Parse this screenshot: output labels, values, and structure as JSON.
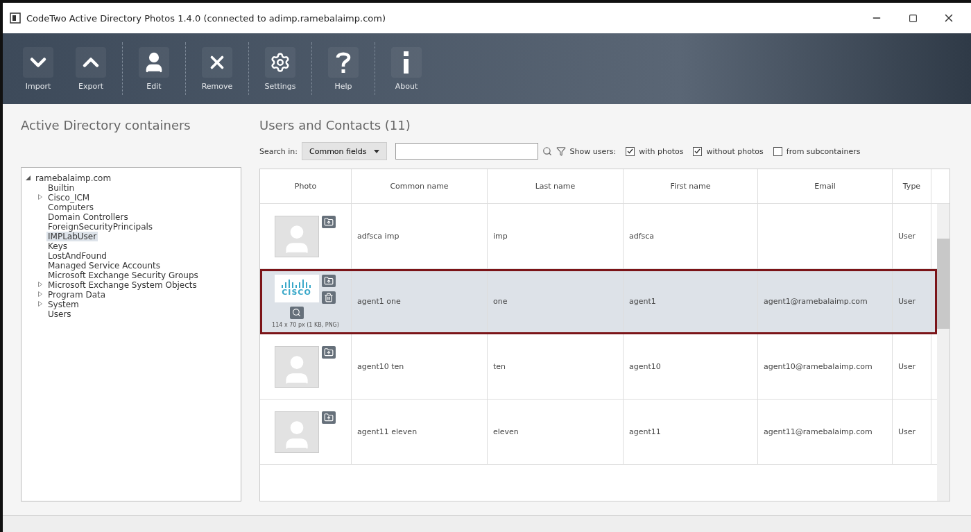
{
  "window": {
    "title": "CodeTwo Active Directory Photos 1.4.0 (connected to adimp.ramebalaimp.com)"
  },
  "toolbar": [
    {
      "label": "Import",
      "kind": "import"
    },
    {
      "label": "Export",
      "kind": "export"
    },
    {
      "label": "Edit",
      "kind": "edit"
    },
    {
      "label": "Remove",
      "kind": "remove"
    },
    {
      "label": "Settings",
      "kind": "settings"
    },
    {
      "label": "Help",
      "kind": "help"
    },
    {
      "label": "About",
      "kind": "about"
    }
  ],
  "sidebar": {
    "title": "Active Directory containers",
    "tree": [
      {
        "label": "ramebalaimp.com",
        "expanded": true,
        "selected": false,
        "children": [
          {
            "label": "Builtin",
            "selected": false
          },
          {
            "label": "Cisco_ICM",
            "expanded": false,
            "selected": false
          },
          {
            "label": "Computers",
            "selected": false
          },
          {
            "label": "Domain Controllers",
            "selected": false
          },
          {
            "label": "ForeignSecurityPrincipals",
            "selected": false
          },
          {
            "label": "IMPLabUser",
            "selected": true
          },
          {
            "label": "Keys",
            "selected": false
          },
          {
            "label": "LostAndFound",
            "selected": false
          },
          {
            "label": "Managed Service Accounts",
            "selected": false
          },
          {
            "label": "Microsoft Exchange Security Groups",
            "selected": false
          },
          {
            "label": "Microsoft Exchange System Objects",
            "expanded": false,
            "selected": false
          },
          {
            "label": "Program Data",
            "expanded": false,
            "selected": false
          },
          {
            "label": "System",
            "expanded": false,
            "selected": false
          },
          {
            "label": "Users",
            "selected": false
          }
        ]
      }
    ]
  },
  "main": {
    "title": "Users and Contacts (11)",
    "search_label": "Search in:",
    "search_scope": "Common fields",
    "show_label": "Show users:",
    "filters": [
      {
        "label": "with photos",
        "checked": true
      },
      {
        "label": "without photos",
        "checked": true
      },
      {
        "label": "from subcontainers",
        "checked": false
      }
    ]
  },
  "table": {
    "photo_column": "Photo",
    "columns": [
      "Common name",
      "Last name",
      "First name",
      "Email",
      "Type"
    ],
    "rows": [
      {
        "photo": {
          "kind": "placeholder"
        },
        "cells": [
          "adfsca imp",
          "imp",
          "adfsca",
          "",
          "User"
        ],
        "selected": false
      },
      {
        "photo": {
          "kind": "logo",
          "text": "CISCO",
          "info": "114 x 70 px (1 KB, PNG)"
        },
        "cells": [
          "agent1 one",
          "one",
          "agent1",
          "agent1@ramebalaimp.com",
          "User"
        ],
        "selected": true
      },
      {
        "photo": {
          "kind": "placeholder"
        },
        "cells": [
          "agent10 ten",
          "ten",
          "agent10",
          "agent10@ramebalaimp.com",
          "User"
        ],
        "selected": false
      },
      {
        "photo": {
          "kind": "placeholder"
        },
        "cells": [
          "agent11 eleven",
          "eleven",
          "agent11",
          "agent11@ramebalaimp.com",
          "User"
        ],
        "selected": false
      }
    ]
  }
}
